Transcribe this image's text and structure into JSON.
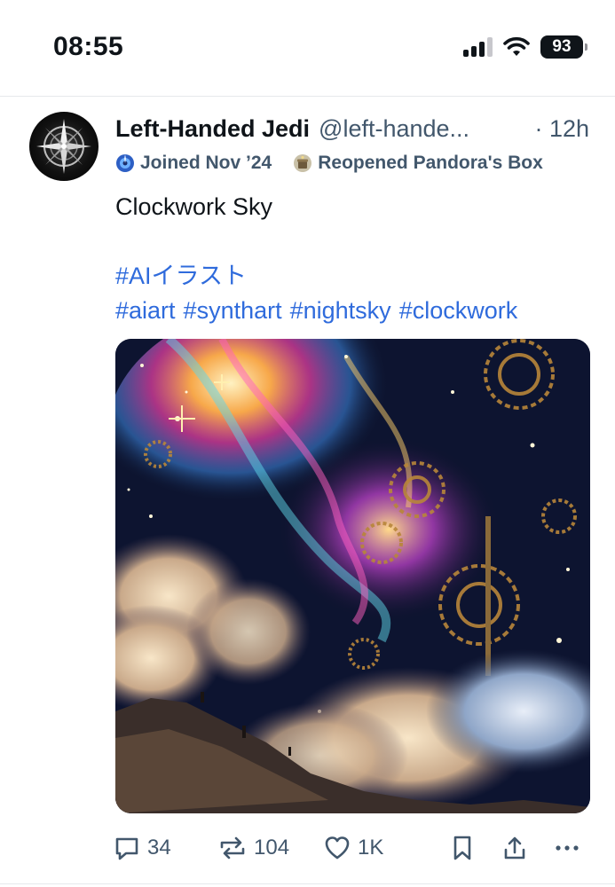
{
  "status_bar": {
    "time": "08:55",
    "battery": "93",
    "icons": [
      "cellular-signal-icon",
      "wifi-icon",
      "battery-icon"
    ]
  },
  "post": {
    "display_name": "Left-Handed Jedi",
    "handle": "@left-hande...",
    "time": "· 12h",
    "badges": [
      {
        "icon": "globe-icon",
        "label": "Joined Nov ’24"
      },
      {
        "icon": "pandora-box-icon",
        "label": "Reopened Pandora's Box"
      }
    ],
    "text": "Clockwork Sky",
    "hashtags": [
      "#AIイラスト",
      "#aiart",
      "#synthart",
      "#nightsky",
      "#clockwork"
    ],
    "image_alt": "Cosmic clockwork sky illustration with gears, nebula and clouds",
    "actions": {
      "reply_count": "34",
      "repost_count": "104",
      "like_count": "1K"
    }
  },
  "colors": {
    "text": "#0f1419",
    "secondary": "#42576c",
    "link": "#2f6bdc",
    "divider": "#e6e8eb"
  }
}
